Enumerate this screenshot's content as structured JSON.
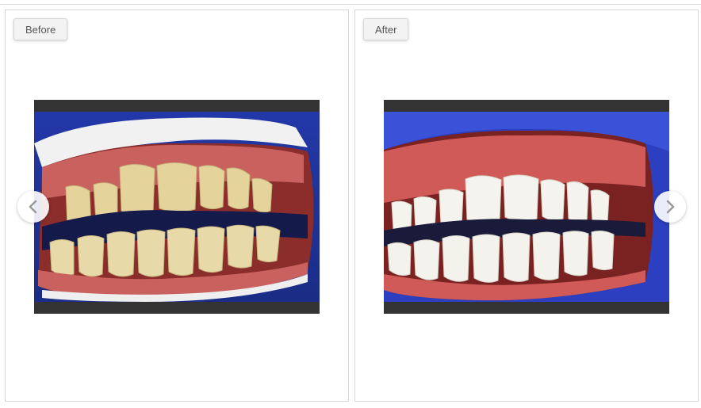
{
  "panels": [
    {
      "label": "Before",
      "image_icon": "teeth-before-photo"
    },
    {
      "label": "After",
      "image_icon": "teeth-after-photo"
    }
  ],
  "navigation": {
    "prev_icon": "chevron-left-icon",
    "next_icon": "chevron-right-icon"
  },
  "colors": {
    "retractor_blue": "#2c3fb8",
    "gum_red": "#c96b6b",
    "teeth_before": "#e2d3a0",
    "teeth_after": "#f2f2ec",
    "frame_dark": "#333333"
  }
}
